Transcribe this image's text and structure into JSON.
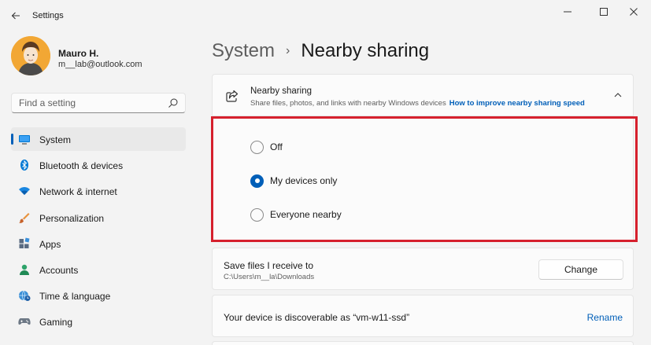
{
  "window": {
    "title": "Settings",
    "back_icon": "arrow-left-icon",
    "controls": [
      "minimize-icon",
      "maximize-icon",
      "close-icon"
    ]
  },
  "profile": {
    "name": "Mauro H.",
    "email": "m__lab@outlook.com"
  },
  "search": {
    "placeholder": "Find a setting",
    "value": ""
  },
  "sidebar": {
    "items": [
      {
        "label": "System",
        "icon": "monitor-icon",
        "active": true
      },
      {
        "label": "Bluetooth & devices",
        "icon": "bluetooth-icon"
      },
      {
        "label": "Network & internet",
        "icon": "wifi-icon"
      },
      {
        "label": "Personalization",
        "icon": "brush-icon"
      },
      {
        "label": "Apps",
        "icon": "apps-icon"
      },
      {
        "label": "Accounts",
        "icon": "person-icon"
      },
      {
        "label": "Time & language",
        "icon": "globe-clock-icon"
      },
      {
        "label": "Gaming",
        "icon": "gamepad-icon"
      }
    ]
  },
  "breadcrumb": {
    "parent": "System",
    "separator": "›",
    "current": "Nearby sharing"
  },
  "nearby": {
    "title": "Nearby sharing",
    "description": "Share files, photos, and links with nearby Windows devices",
    "link": "How to improve nearby sharing speed",
    "options": [
      {
        "label": "Off",
        "checked": false
      },
      {
        "label": "My devices only",
        "checked": true
      },
      {
        "label": "Everyone nearby",
        "checked": false
      }
    ]
  },
  "save_location": {
    "title": "Save files I receive to",
    "path": "C:\\Users\\m__la\\Downloads",
    "button": "Change"
  },
  "discoverable": {
    "text": "Your device is discoverable as “vm-w11-ssd”",
    "action": "Rename"
  },
  "colors": {
    "accent": "#005fb8",
    "highlight": "#d6202d",
    "background": "#f3f3f3",
    "card": "#fbfbfb"
  }
}
